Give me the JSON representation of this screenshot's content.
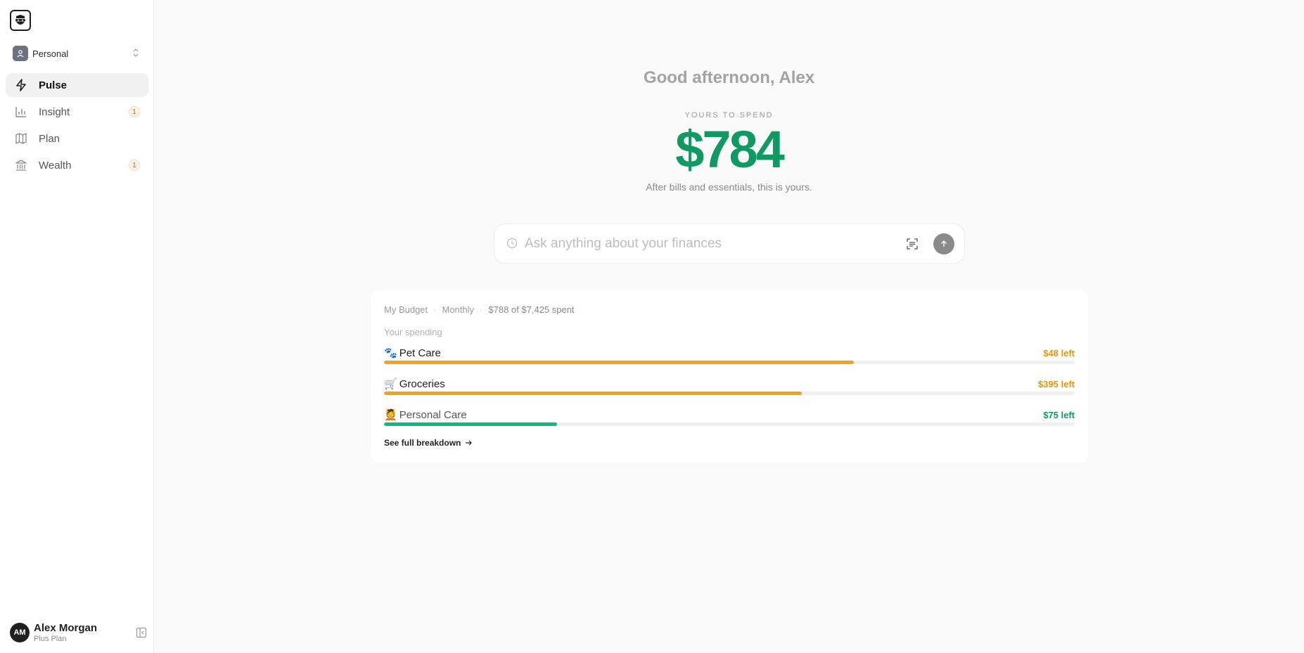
{
  "sidebar": {
    "workspace": "Personal",
    "items": [
      {
        "label": "Pulse",
        "icon": "bolt-icon",
        "badge": ""
      },
      {
        "label": "Insight",
        "icon": "bar-chart-icon",
        "badge": "1"
      },
      {
        "label": "Plan",
        "icon": "map-icon",
        "badge": ""
      },
      {
        "label": "Wealth",
        "icon": "bank-icon",
        "badge": "1"
      }
    ]
  },
  "user": {
    "initials": "AM",
    "name": "Alex Morgan",
    "plan": "Plus Plan"
  },
  "main": {
    "greeting": "Good afternoon, Alex",
    "spend_label": "YOURS TO SPEND",
    "amount": "$784",
    "after_text": "After bills and essentials, this is yours.",
    "ask_placeholder": "Ask anything about your finances"
  },
  "budget": {
    "name": "My Budget",
    "period": "Monthly",
    "spent": "$788 of $7,425 spent",
    "spending_title": "Your spending",
    "categories": [
      {
        "emoji": "🐾",
        "name": "Pet Care",
        "left": "$48 left",
        "progress": 0.68,
        "color": "#f2a31b",
        "text_color": "#e0960f"
      },
      {
        "emoji": "🛒",
        "name": "Groceries",
        "left": "$395 left",
        "progress": 0.605,
        "color": "#f2a31b",
        "text_color": "#e0960f"
      },
      {
        "emoji": "💆",
        "name": "Personal Care",
        "left": "$75 left",
        "progress": 0.25,
        "color": "#10b981",
        "text_color": "#0f9a63"
      }
    ],
    "breakdown_label": "See full breakdown"
  },
  "colors": {
    "accent": "#0f9a63",
    "warning": "#f2a31b"
  }
}
